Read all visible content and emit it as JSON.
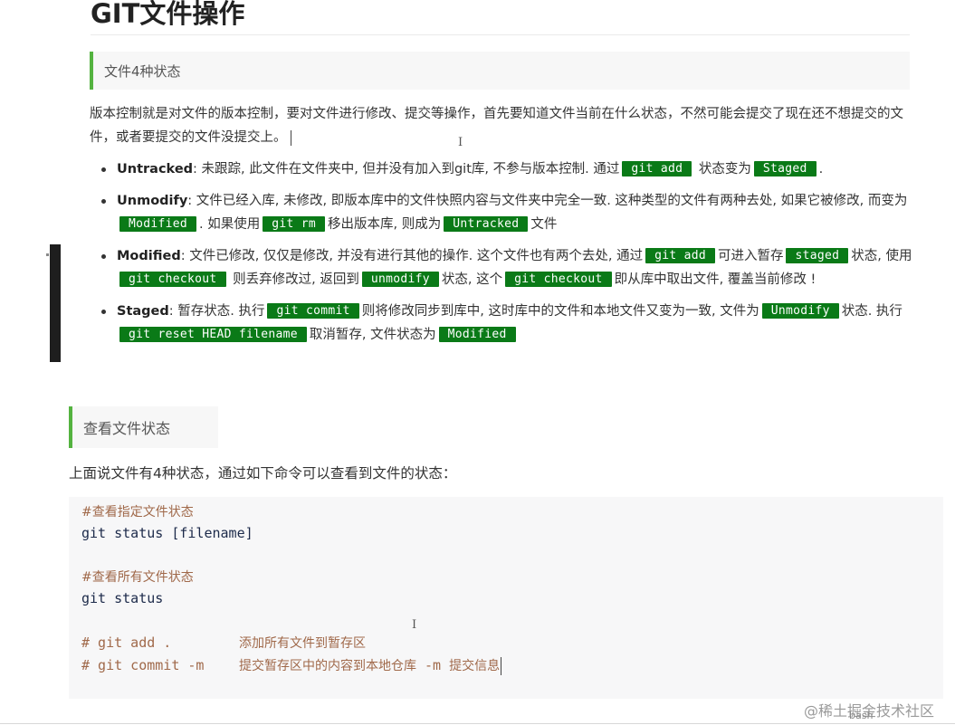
{
  "page": {
    "title": "GIT文件操作"
  },
  "section1": {
    "heading": "文件4种状态",
    "intro": "版本控制就是对文件的版本控制，要对文件进行修改、提交等操作，首先要知道文件当前在什么状态，不然可能会提交了现在还不想提交的文件，或者要提交的文件没提交上。",
    "items": [
      {
        "term": "Untracked",
        "t1": ": 未跟踪, 此文件在文件夹中, 但并没有加入到git库, 不参与版本控制. 通过",
        "c1": "git add",
        "t2": " 状态变为",
        "c2": "Staged",
        "t3": "."
      },
      {
        "term": "Unmodify",
        "t1": ": 文件已经入库, 未修改, 即版本库中的文件快照内容与文件夹中完全一致. 这种类型的文件有两种去处, 如果它被修改, 而变为",
        "c1": "Modified",
        "t2": ". 如果使用",
        "c2": "git rm",
        "t3": "移出版本库, 则成为",
        "c3": "Untracked",
        "t4": "文件"
      },
      {
        "term": "Modified",
        "t1": ": 文件已修改, 仅仅是修改, 并没有进行其他的操作. 这个文件也有两个去处, 通过",
        "c1": "git add",
        "t2": "可进入暂存",
        "c2": "staged",
        "t3": "状态, 使用",
        "c3": "git checkout",
        "t4": " 则丢弃修改过, 返回到",
        "c4": "unmodify",
        "t5": "状态, 这个",
        "c5": "git checkout",
        "t6": "即从库中取出文件, 覆盖当前修改 !"
      },
      {
        "term": "Staged",
        "t1": ": 暂存状态. 执行",
        "c1": "git commit",
        "t2": "则将修改同步到库中, 这时库中的文件和本地文件又变为一致, 文件为",
        "c2": "Unmodify",
        "t3": "状态. 执行",
        "c3": "git reset HEAD filename",
        "t4": "取消暂存, 文件状态为",
        "c4": "Modified"
      }
    ]
  },
  "section2": {
    "heading": "查看文件状态",
    "intro": "上面说文件有4种状态，通过如下命令可以查看到文件的状态：",
    "code": {
      "line1": "#查看指定文件状态",
      "line2": "git status [filename]",
      "line3": "#查看所有文件状态",
      "line4": "git status",
      "line5_cmd": "# git add .",
      "line5_note": "添加所有文件到暂存区",
      "line6_cmd": "# git commit -m",
      "line6_note_a": "提交暂存区中的内容到本地仓库",
      "line6_flag": " -m ",
      "line6_note_b": "提交信息"
    },
    "lang": "bash"
  },
  "watermark": "@稀土掘金技术社区",
  "text_cursor_glyph": "I"
}
